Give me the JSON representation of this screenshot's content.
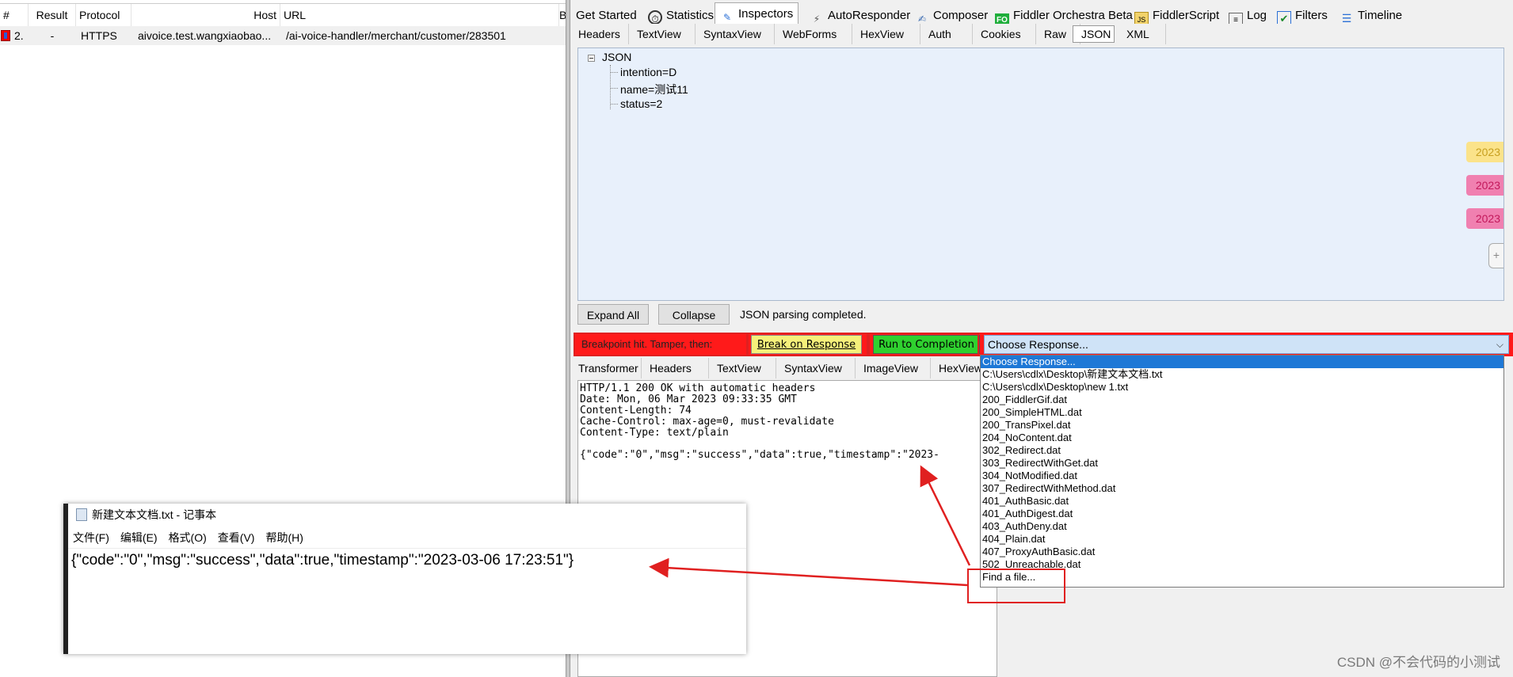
{
  "session_list": {
    "columns": [
      "#",
      "Result",
      "Protocol",
      "Host",
      "URL",
      "B"
    ],
    "row": {
      "num": "2.",
      "result": "-",
      "protocol": "HTTPS",
      "host": "aivoice.test.wangxiaobao...",
      "url": "/ai-voice-handler/merchant/customer/283501"
    }
  },
  "main_tabs": [
    {
      "label": "Get Started",
      "icon": "none"
    },
    {
      "label": "Statistics",
      "icon": "stopwatch-icon"
    },
    {
      "label": "Inspectors",
      "icon": "inspectors-icon"
    },
    {
      "label": "AutoResponder",
      "icon": "lightning-icon"
    },
    {
      "label": "Composer",
      "icon": "composer-icon"
    },
    {
      "label": "Fiddler Orchestra Beta",
      "icon": "fo-icon",
      "icon_text": "FO"
    },
    {
      "label": "FiddlerScript",
      "icon": "script-icon"
    },
    {
      "label": "Log",
      "icon": "log-icon"
    },
    {
      "label": "Filters",
      "icon": "checkbox-icon"
    },
    {
      "label": "Timeline",
      "icon": "timeline-icon"
    }
  ],
  "request_tabs": [
    "Headers",
    "TextView",
    "SyntaxView",
    "WebForms",
    "HexView",
    "Auth",
    "Cookies",
    "Raw",
    "JSON",
    "XML"
  ],
  "json_tree": {
    "root": "JSON",
    "nodes": [
      "intention=D",
      "name=测试11",
      "status=2"
    ]
  },
  "side_flags": [
    "2023",
    "2023",
    "2023"
  ],
  "request_footer": {
    "expand_all": "Expand All",
    "collapse": "Collapse",
    "status": "JSON parsing completed."
  },
  "breakpoint_bar": {
    "label": "Breakpoint hit. Tamper, then:",
    "break_on_response": "Break on Response",
    "run_to_completion": "Run to Completion",
    "choose_response": "Choose Response..."
  },
  "response_tabs": [
    "Transformer",
    "Headers",
    "TextView",
    "SyntaxView",
    "ImageView",
    "HexView"
  ],
  "response_text": {
    "lines": [
      "HTTP/1.1 200 OK with automatic headers",
      "Date: Mon, 06 Mar 2023 09:33:35 GMT",
      "Content-Length: 74",
      "Cache-Control: max-age=0, must-revalidate",
      "Content-Type: text/plain",
      "",
      "{\"code\":\"0\",\"msg\":\"success\",\"data\":true,\"timestamp\":\"2023-"
    ]
  },
  "dropdown_options": [
    "Choose Response...",
    "C:\\Users\\cdlx\\Desktop\\新建文本文档.txt",
    "C:\\Users\\cdlx\\Desktop\\new 1.txt",
    "200_FiddlerGif.dat",
    "200_SimpleHTML.dat",
    "200_TransPixel.dat",
    "204_NoContent.dat",
    "302_Redirect.dat",
    "303_RedirectWithGet.dat",
    "304_NotModified.dat",
    "307_RedirectWithMethod.dat",
    "401_AuthBasic.dat",
    "401_AuthDigest.dat",
    "403_AuthDeny.dat",
    "404_Plain.dat",
    "407_ProxyAuthBasic.dat",
    "502_Unreachable.dat",
    "Find a file..."
  ],
  "notepad": {
    "title": "新建文本文档.txt - 记事本",
    "menu": [
      "文件(F)",
      "编辑(E)",
      "格式(O)",
      "查看(V)",
      "帮助(H)"
    ],
    "content": "{\"code\":\"0\",\"msg\":\"success\",\"data\":true,\"timestamp\":\"2023-03-06 17:23:51\"}"
  },
  "watermark": "CSDN @不会代码的小测试",
  "colors": {
    "breakpoint_bar": "#ff1a1a",
    "break_on_response_btn": "#f5f07a",
    "run_to_completion_btn": "#2fd12f",
    "tree_bg": "#e8f0fb",
    "dropdown_selected": "#1e78d6",
    "annotation_red": "#e02020"
  }
}
